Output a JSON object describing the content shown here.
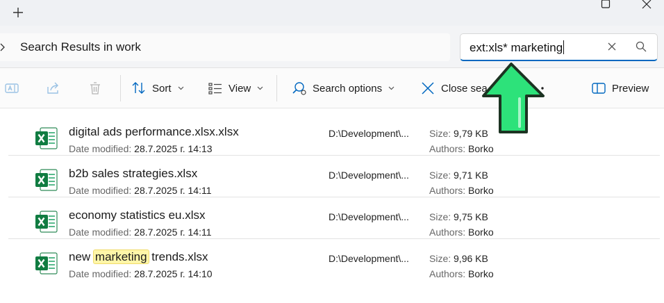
{
  "titlebar": {
    "new_tab_icon": "plus-icon",
    "controls": [
      "maximize-icon",
      "close-icon"
    ]
  },
  "address_bar": {
    "chevron_icon": "chevron-right-icon",
    "breadcrumb_text": "Search Results in work"
  },
  "search": {
    "value": "ext:xls* marketing",
    "clear_icon": "close-icon",
    "search_icon": "search-icon",
    "accent": "#0067c0"
  },
  "toolbar": {
    "sort_label": "Sort",
    "view_label": "View",
    "search_options_label": "Search options",
    "close_search_label": "Close sea",
    "preview_label": "Preview"
  },
  "files": [
    {
      "name": "digital ads performance.xlsx.xlsx",
      "date_label": "Date modified:",
      "date": "28.7.2025 г. 14:13",
      "path": "D:\\Development\\...",
      "size_label": "Size:",
      "size": "9,79 KB",
      "authors_label": "Authors:",
      "authors": "Borko"
    },
    {
      "name": "b2b sales strategies.xlsx",
      "date_label": "Date modified:",
      "date": "28.7.2025 г. 14:11",
      "path": "D:\\Development\\...",
      "size_label": "Size:",
      "size": "9,71 KB",
      "authors_label": "Authors:",
      "authors": "Borko"
    },
    {
      "name": "economy statistics eu.xlsx",
      "date_label": "Date modified:",
      "date": "28.7.2025 г. 14:11",
      "path": "D:\\Development\\...",
      "size_label": "Size:",
      "size": "9,75 KB",
      "authors_label": "Authors:",
      "authors": "Borko"
    },
    {
      "name_pre": "new ",
      "name_highlight": "marketing",
      "name_post": " trends.xlsx",
      "date_label": "Date modified:",
      "date": "28.7.2025 г. 14:10",
      "path": "D:\\Development\\...",
      "size_label": "Size:",
      "size": "9,96 KB",
      "authors_label": "Authors:",
      "authors": "Borko"
    }
  ],
  "colors": {
    "excel_green": "#107c41",
    "arrow_green": "#2de27a",
    "arrow_outline": "#1c3322"
  }
}
